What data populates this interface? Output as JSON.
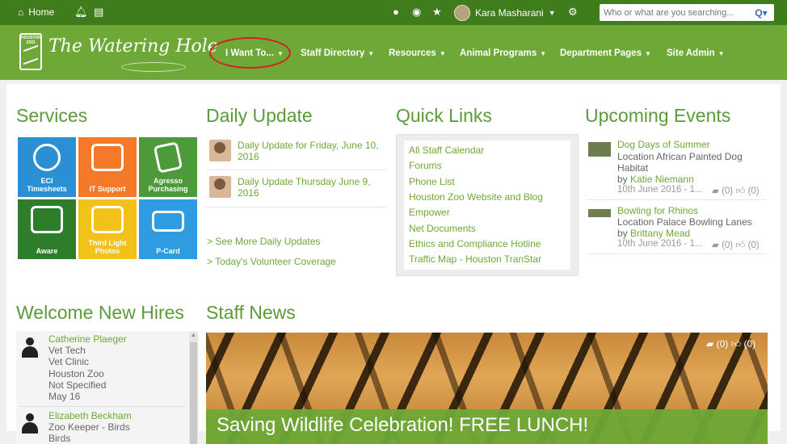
{
  "topbar": {
    "home_label": "Home",
    "icons": [
      "home-icon",
      "bell-icon",
      "document-icon",
      "alert-icon",
      "eye-icon",
      "star-icon",
      "gear-icon"
    ],
    "user_name": "Kara Masharani",
    "search_placeholder": "Who or what are you searching..."
  },
  "nav": {
    "brand_badge": "HOUSTON ZOO",
    "brand": "The Watering Hole",
    "items": [
      {
        "label": "I Want To..."
      },
      {
        "label": "Staff Directory"
      },
      {
        "label": "Resources"
      },
      {
        "label": "Animal Programs"
      },
      {
        "label": "Department Pages"
      },
      {
        "label": "Site Admin"
      }
    ]
  },
  "services": {
    "title": "Services",
    "tiles": [
      {
        "label_line1": "ECI",
        "label_line2": "Timesheets",
        "color": "#2b8fd4",
        "icon": "clock-icon"
      },
      {
        "label_line1": "IT Support",
        "label_line2": "",
        "color": "#f47a2a",
        "icon": "headset-icon"
      },
      {
        "label_line1": "Agresso",
        "label_line2": "Purchasing",
        "color": "#4c9a3a",
        "icon": "clipboard-icon"
      },
      {
        "label_line1": "Aware",
        "label_line2": "",
        "color": "#2d7d2a",
        "icon": "tablet-icon"
      },
      {
        "label_line1": "Third Light",
        "label_line2": "Photos",
        "color": "#f3c21a",
        "icon": "camera-icon"
      },
      {
        "label_line1": "P-Card",
        "label_line2": "",
        "color": "#2f9be0",
        "icon": "credit-card-icon"
      }
    ]
  },
  "daily_update": {
    "title": "Daily Update",
    "items": [
      {
        "title": "Daily Update for Friday, June 10, 2016"
      },
      {
        "title": "Daily Update Thursday June 9, 2016"
      }
    ],
    "see_more": "> See More Daily Updates",
    "volunteer": "> Today's Volunteer Coverage"
  },
  "quick_links": {
    "title": "Quick Links",
    "links": [
      "All Staff Calendar",
      "Forums",
      "Phone List",
      "Houston Zoo Website and Blog",
      "Empower",
      "Net Documents",
      "Ethics and Compliance Hotline",
      "Traffic Map - Houston TranStar"
    ]
  },
  "events": {
    "title": "Upcoming Events",
    "items": [
      {
        "title": "Dog Days of Summer",
        "location_line1": "Location African Painted Dog",
        "location_line2": "Habitat",
        "by_label": "by",
        "author": "Katie Niemann",
        "date": "10th June 2016 - 1...",
        "comments": "(0)",
        "likes": "(0)"
      },
      {
        "title": "Bowling for Rhinos",
        "location_line1": "Location Palace Bowling Lanes",
        "location_line2": "",
        "by_label": "by",
        "author": "Brittany Mead",
        "date": "10th June 2016 - 1...",
        "comments": "(0)",
        "likes": "(0)"
      }
    ]
  },
  "hires": {
    "title": "Welcome New Hires",
    "people": [
      {
        "name": "Catherine Plaeger",
        "lines": [
          "Vet Tech",
          "Vet Clinic",
          "Houston Zoo",
          "Not Specified",
          "May 16"
        ]
      },
      {
        "name": "Elizabeth Beckham",
        "lines": [
          "Zoo Keeper - Birds",
          "Birds"
        ]
      }
    ]
  },
  "news": {
    "title": "Staff News",
    "headline": "Saving Wildlife Celebration! FREE LUNCH!",
    "comments": "(0)",
    "likes": "(0)"
  }
}
